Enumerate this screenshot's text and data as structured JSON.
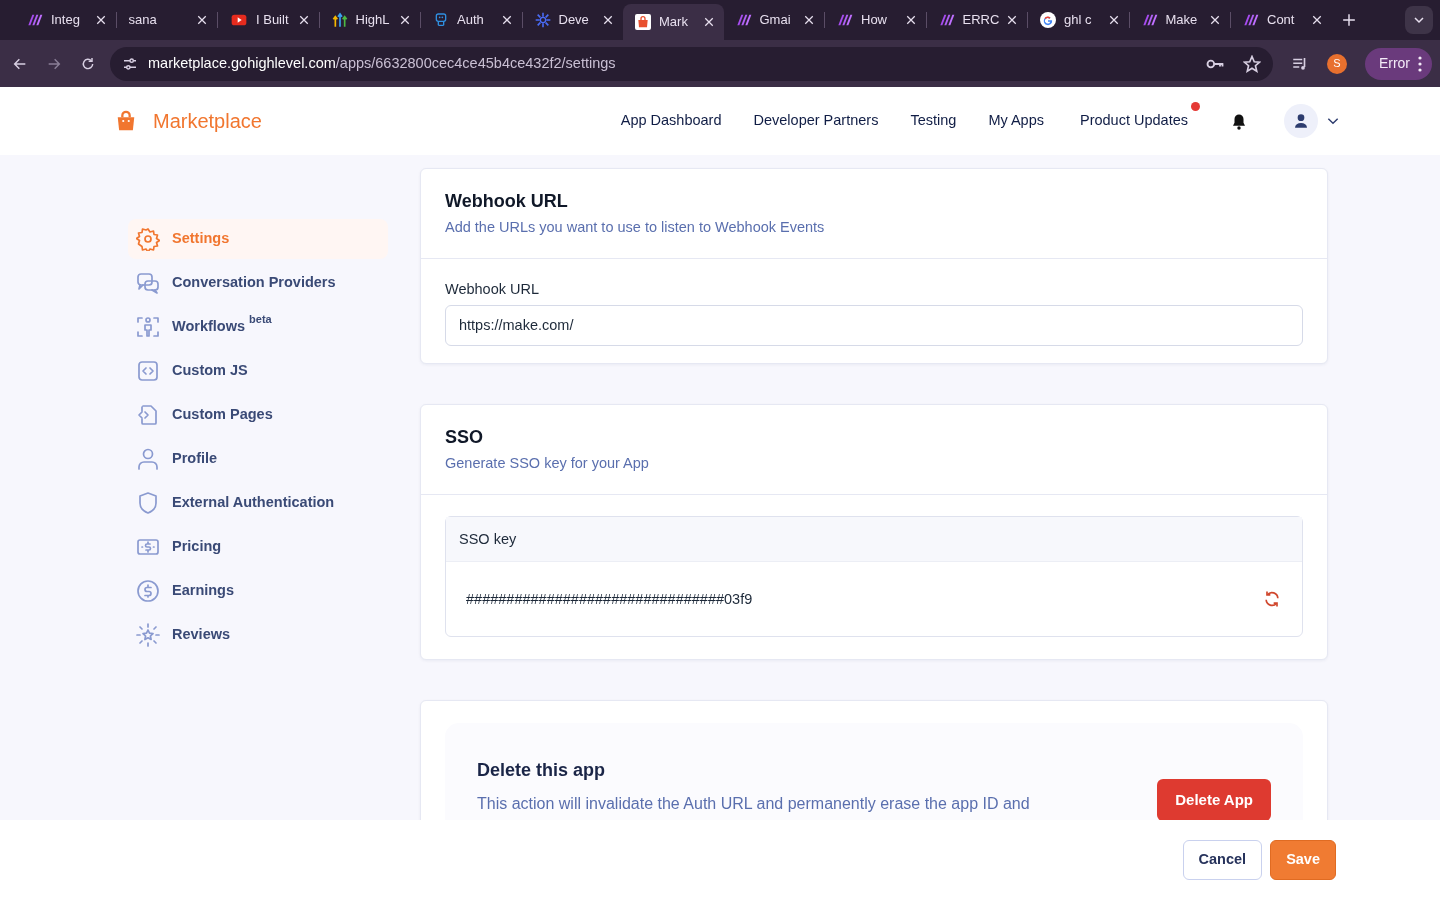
{
  "browser": {
    "tabs": [
      {
        "title": "Integ",
        "selected": false
      },
      {
        "title": "sana",
        "selected": false
      },
      {
        "title": "I Built",
        "selected": false
      },
      {
        "title": "HighL",
        "selected": false
      },
      {
        "title": "Auth",
        "selected": false
      },
      {
        "title": "Deve",
        "selected": false
      },
      {
        "title": "Mark",
        "selected": true
      },
      {
        "title": "Gmai",
        "selected": false
      },
      {
        "title": "How",
        "selected": false
      },
      {
        "title": "ERRC",
        "selected": false
      },
      {
        "title": "ghl c",
        "selected": false
      },
      {
        "title": "Make",
        "selected": false
      },
      {
        "title": "Cont",
        "selected": false
      }
    ],
    "url_host": "marketplace.gohighlevel.com",
    "url_path": "/apps/6632800cec4ce45b4ce432f2/settings",
    "profile_initial": "S",
    "error_button": "Error"
  },
  "header": {
    "brand": "Marketplace",
    "nav": [
      {
        "label": "App Dashboard",
        "unread": false
      },
      {
        "label": "Developer Partners",
        "unread": false
      },
      {
        "label": "Testing",
        "unread": false
      },
      {
        "label": "My Apps",
        "unread": false
      },
      {
        "label": "Product Updates",
        "unread": true
      }
    ]
  },
  "sidebar": {
    "items": [
      {
        "label": "Settings",
        "selected": true
      },
      {
        "label": "Conversation Providers",
        "selected": false
      },
      {
        "label": "Workflows",
        "sup": "beta",
        "selected": false
      },
      {
        "label": "Custom JS",
        "selected": false
      },
      {
        "label": "Custom Pages",
        "selected": false
      },
      {
        "label": "Profile",
        "selected": false
      },
      {
        "label": "External Authentication",
        "selected": false
      },
      {
        "label": "Pricing",
        "selected": false
      },
      {
        "label": "Earnings",
        "selected": false
      },
      {
        "label": "Reviews",
        "selected": false
      }
    ]
  },
  "webhook": {
    "title": "Webhook URL",
    "subtitle": "Add the URLs you want to use to listen to Webhook Events",
    "field_label": "Webhook URL",
    "value": "https://make.com/"
  },
  "sso": {
    "title": "SSO",
    "subtitle": "Generate SSO key for your App",
    "key_label": "SSO key",
    "key_value": "################################03f9"
  },
  "delete": {
    "title": "Delete this app",
    "description": "This action will invalidate the Auth URL and permanently erase the app ID and",
    "button": "Delete App"
  },
  "footer": {
    "buttons": [
      {
        "label": "Cancel",
        "kind": "secondary"
      },
      {
        "label": "Save",
        "kind": "primary"
      }
    ]
  }
}
